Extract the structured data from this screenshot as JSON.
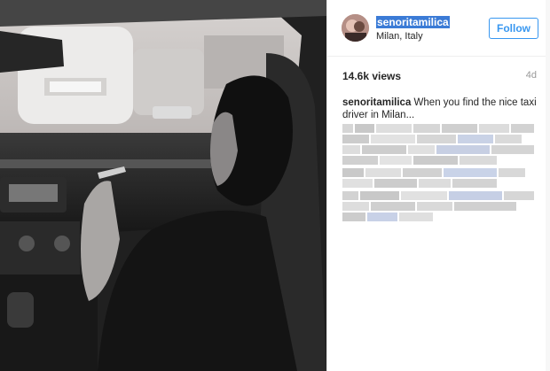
{
  "photo": {
    "alt": "Black and white photo of a woman sitting in a taxi"
  },
  "post": {
    "username": "senoritamilica",
    "location": "Milan, Italy",
    "follow_label": "Follow",
    "views": "14.6k views",
    "age": "4d",
    "caption_user": "senoritamilica",
    "caption_text": "When you find the nice taxi driver in Milan..."
  },
  "colors": {
    "accent": "#3897f0",
    "selection": "#3b7bd6",
    "panel_bg": "#ffffff"
  }
}
